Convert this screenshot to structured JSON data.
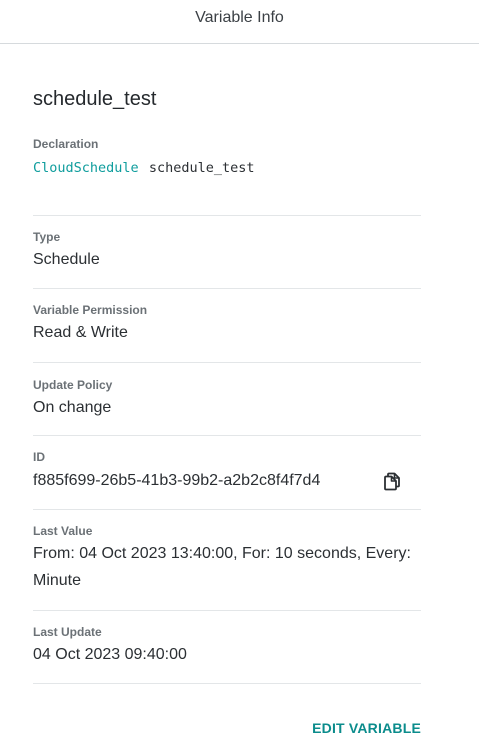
{
  "header": {
    "title": "Variable Info"
  },
  "variable": {
    "name": "schedule_test"
  },
  "fields": {
    "declaration": {
      "label": "Declaration",
      "type": "CloudSchedule",
      "name": "schedule_test"
    },
    "type": {
      "label": "Type",
      "value": "Schedule"
    },
    "permission": {
      "label": "Variable Permission",
      "value": "Read & Write"
    },
    "update_policy": {
      "label": "Update Policy",
      "value": "On change"
    },
    "id": {
      "label": "ID",
      "value": "f885f699-26b5-41b3-99b2-a2b2c8f4f7d4",
      "copy_icon": "copy-icon"
    },
    "last_value": {
      "label": "Last Value",
      "value": "From: 04 Oct 2023 13:40:00, For: 10 seconds, Every: Minute"
    },
    "last_update": {
      "label": "Last Update",
      "value": "04 Oct 2023 09:40:00"
    }
  },
  "actions": {
    "edit_label": "EDIT VARIABLE"
  },
  "colors": {
    "accent": "#0b8c8c",
    "declaration_type": "#0f9d9d",
    "divider": "#e3e6e8"
  }
}
